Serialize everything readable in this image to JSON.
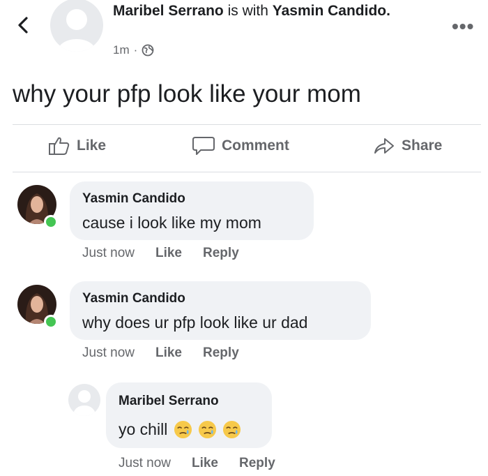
{
  "header": {
    "author": "Maribel Serrano",
    "with_text": " is with ",
    "tagged": "Yasmin Candido.",
    "time": "1m",
    "dot": "·",
    "more": "•••"
  },
  "post": {
    "text": "why your pfp look like your mom"
  },
  "actions": {
    "like": "Like",
    "comment": "Comment",
    "share": "Share"
  },
  "comments": [
    {
      "name": "Yasmin Candido",
      "text": "cause i look like my mom",
      "time": "Just now",
      "like": "Like",
      "reply": "Reply"
    },
    {
      "name": "Yasmin Candido",
      "text": "why does ur pfp look like ur dad",
      "time": "Just now",
      "like": "Like",
      "reply": "Reply"
    }
  ],
  "reply": {
    "name": "Maribel Serrano",
    "text": "yo chill",
    "emojis": [
      "sad-relieved-face",
      "sad-relieved-face",
      "sad-relieved-face"
    ],
    "time": "Just now",
    "like": "Like",
    "reply": "Reply"
  },
  "colors": {
    "online": "#44c553",
    "bubble": "#f0f2f5",
    "muted": "#65676b"
  }
}
